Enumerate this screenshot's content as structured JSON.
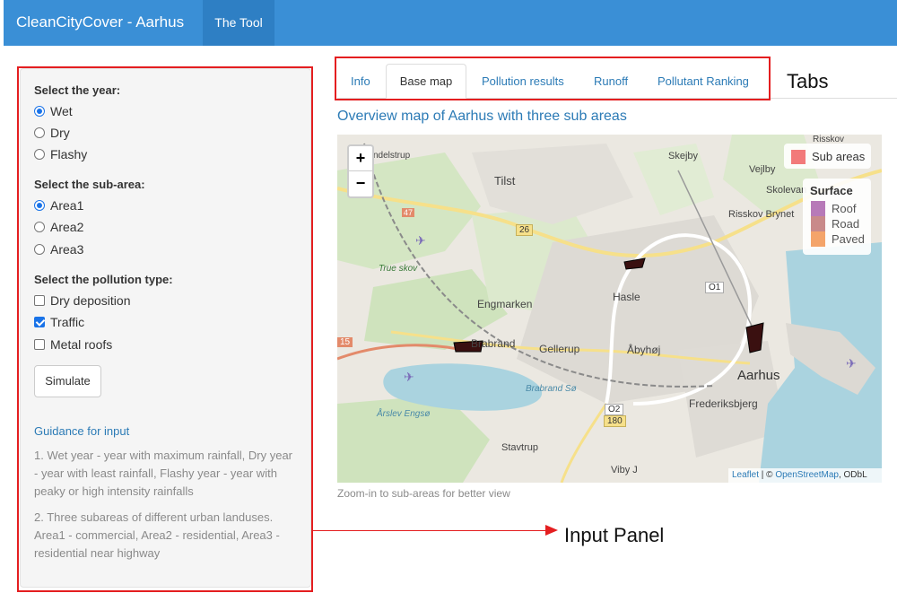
{
  "navbar": {
    "brand": "CleanCityCover - Aarhus",
    "tab_label": "The Tool"
  },
  "sidebar": {
    "year": {
      "label": "Select the year:",
      "options": [
        "Wet",
        "Dry",
        "Flashy"
      ],
      "selected": "Wet"
    },
    "subarea": {
      "label": "Select the sub-area:",
      "options": [
        "Area1",
        "Area2",
        "Area3"
      ],
      "selected": "Area1"
    },
    "pollution": {
      "label": "Select the pollution type:",
      "options": [
        {
          "label": "Dry deposition",
          "checked": false
        },
        {
          "label": "Traffic",
          "checked": true
        },
        {
          "label": "Metal roofs",
          "checked": false
        }
      ]
    },
    "simulate_label": "Simulate",
    "guidance": {
      "heading": "Guidance for input",
      "text1": "1. Wet year - year with maximum rainfall, Dry year - year with least rainfall, Flashy year - year with peaky or high intensity rainfalls",
      "text2": "2. Three subareas of different urban landuses. Area1 - commercial, Area2 - residential, Area3 - residential near highway"
    }
  },
  "tabs": [
    "Info",
    "Base map",
    "Pollution results",
    "Runoff",
    "Pollutant Ranking"
  ],
  "active_tab": "Base map",
  "main": {
    "title": "Overview map of Aarhus with three sub areas",
    "caption": "Zoom-in to sub-areas for better view"
  },
  "map": {
    "zoom_in": "+",
    "zoom_out": "−",
    "legend_subareas": {
      "label": "Sub areas",
      "color": "#f27a7a"
    },
    "legend_surface": {
      "title": "Surface",
      "items": [
        {
          "label": "Roof",
          "color": "#b77ab8"
        },
        {
          "label": "Road",
          "color": "#c98a8a"
        },
        {
          "label": "Paved",
          "color": "#f4a46a"
        }
      ]
    },
    "attribution": {
      "leaflet": "Leaflet",
      "sep": " | © ",
      "osm": "OpenStreetMap",
      "odbl": ", ODbL"
    },
    "places": [
      "Tilst",
      "Skejby",
      "Vejlby",
      "Skolevan",
      "Risskov",
      "Risskov Brynet",
      "Engmarken",
      "Hasle",
      "Brabrand",
      "Gellerup",
      "Åbyhøj",
      "Aarhus",
      "Frederiksbjerg",
      "Stavtrup",
      "Viby J",
      "True skov",
      "Brabrand Sø",
      "Årslev Engsø",
      "ndelstrup"
    ],
    "road_labels": [
      "26",
      "O1",
      "O2",
      "180",
      "15",
      "47"
    ]
  },
  "annotations": {
    "tabs": "Tabs",
    "input_panel": "Input Panel"
  }
}
